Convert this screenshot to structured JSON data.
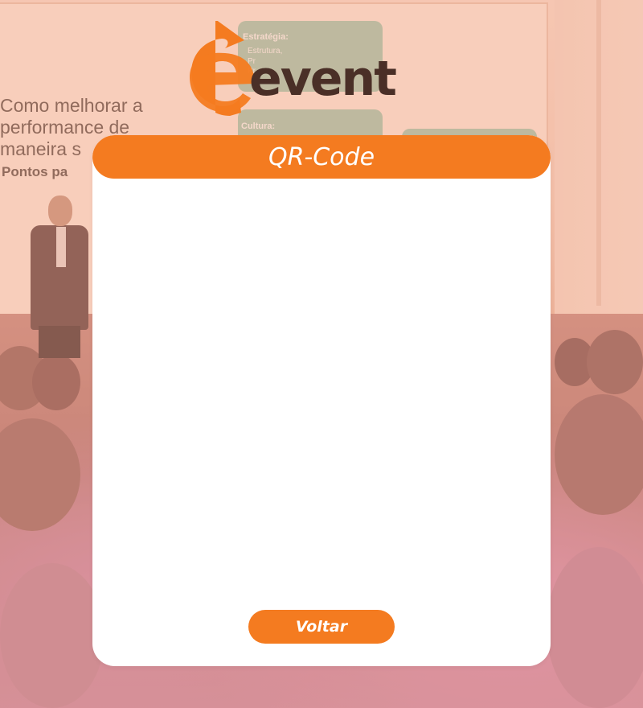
{
  "colors": {
    "accent": "#f47b20",
    "logo_text": "#4a2f27",
    "card": "#ffffff",
    "overlay_tint": "#f5966e"
  },
  "logo": {
    "wordmark": "event",
    "icon": "e-arrow-logo-icon"
  },
  "background": {
    "slide_title": "Como melhorar a\nperformance de\nmaneira s",
    "slide_subtitle": "Pontos pa",
    "box1_label": "Estratégia:",
    "box1_items": [
      "Estrutura,",
      "Pr",
      "Pr"
    ],
    "box2_label": "Cultura:"
  },
  "modal": {
    "title": "QR-Code",
    "qr_content": "",
    "back_label": "Voltar"
  }
}
